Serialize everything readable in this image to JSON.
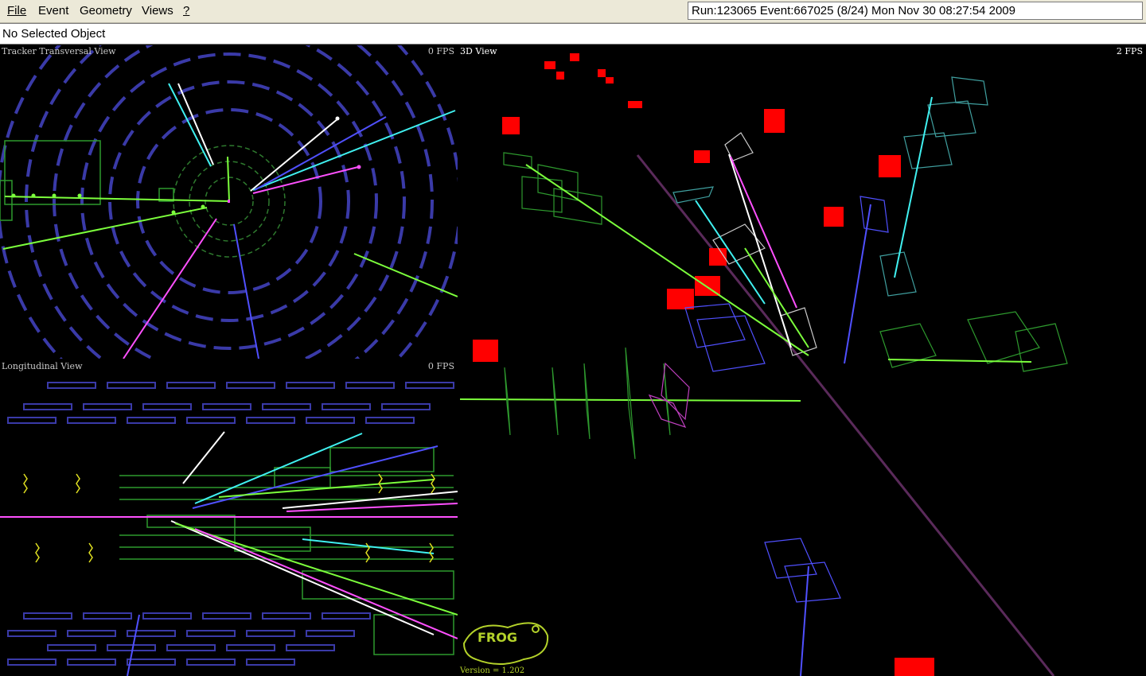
{
  "menu": {
    "file": "File",
    "event": "Event",
    "geometry": "Geometry",
    "views": "Views",
    "help": "?"
  },
  "run_info": "Run:123065 Event:667025 (8/24) Mon Nov 30 08:27:54 2009",
  "selection": "No Selected Object",
  "views": {
    "transverse": {
      "title": "Tracker Transversal View",
      "fps": "0 FPS"
    },
    "longitudinal": {
      "title": "Longitudinal View",
      "fps": "0 FPS"
    },
    "three_d": {
      "title": "3D View",
      "fps": "2 FPS"
    }
  },
  "logo": {
    "text": "FROG",
    "version": "Version =   1.202"
  },
  "colors": {
    "tracker": "#3a3aa8",
    "green_module": "#2e9a2e",
    "lime_track": "#7cff3c",
    "cyan_track": "#40f0f0",
    "magenta_track": "#ff50ff",
    "blue_track": "#5050ff",
    "white_track": "#ffffff",
    "calo": "#ff0000",
    "beamline": "#5a2a5a",
    "pixel": "#e0e020"
  }
}
